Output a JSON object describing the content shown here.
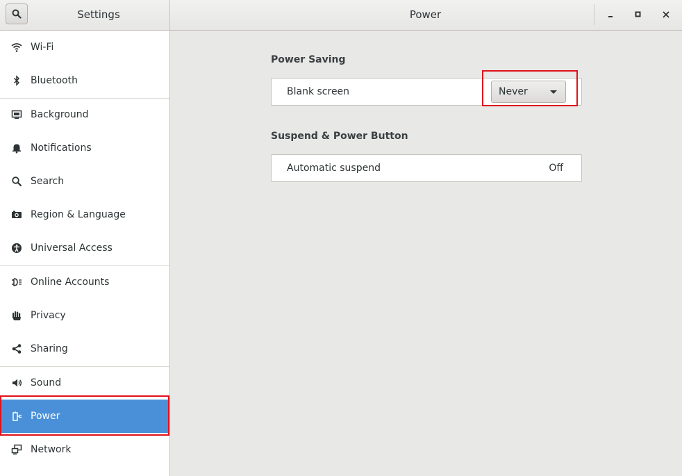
{
  "header": {
    "sidebar_title": "Settings",
    "panel_title": "Power"
  },
  "sidebar": {
    "items": [
      {
        "label": "Wi-Fi",
        "icon": "wifi-icon"
      },
      {
        "label": "Bluetooth",
        "icon": "bluetooth-icon"
      },
      {
        "label": "Background",
        "icon": "background-icon"
      },
      {
        "label": "Notifications",
        "icon": "bell-icon"
      },
      {
        "label": "Search",
        "icon": "search-icon"
      },
      {
        "label": "Region & Language",
        "icon": "camera-icon"
      },
      {
        "label": "Universal Access",
        "icon": "accessibility-icon"
      },
      {
        "label": "Online Accounts",
        "icon": "online-accounts-icon"
      },
      {
        "label": "Privacy",
        "icon": "hand-icon"
      },
      {
        "label": "Sharing",
        "icon": "share-icon"
      },
      {
        "label": "Sound",
        "icon": "speaker-icon"
      },
      {
        "label": "Power",
        "icon": "power-icon",
        "active": true
      },
      {
        "label": "Network",
        "icon": "network-icon"
      }
    ]
  },
  "main": {
    "power_saving": {
      "title": "Power Saving",
      "blank_screen_label": "Blank screen",
      "blank_screen_value": "Never"
    },
    "suspend": {
      "title": "Suspend & Power Button",
      "automatic_suspend_label": "Automatic suspend",
      "automatic_suspend_value": "Off"
    }
  },
  "colors": {
    "accent": "#4a90d9",
    "highlight": "#e0111a"
  }
}
